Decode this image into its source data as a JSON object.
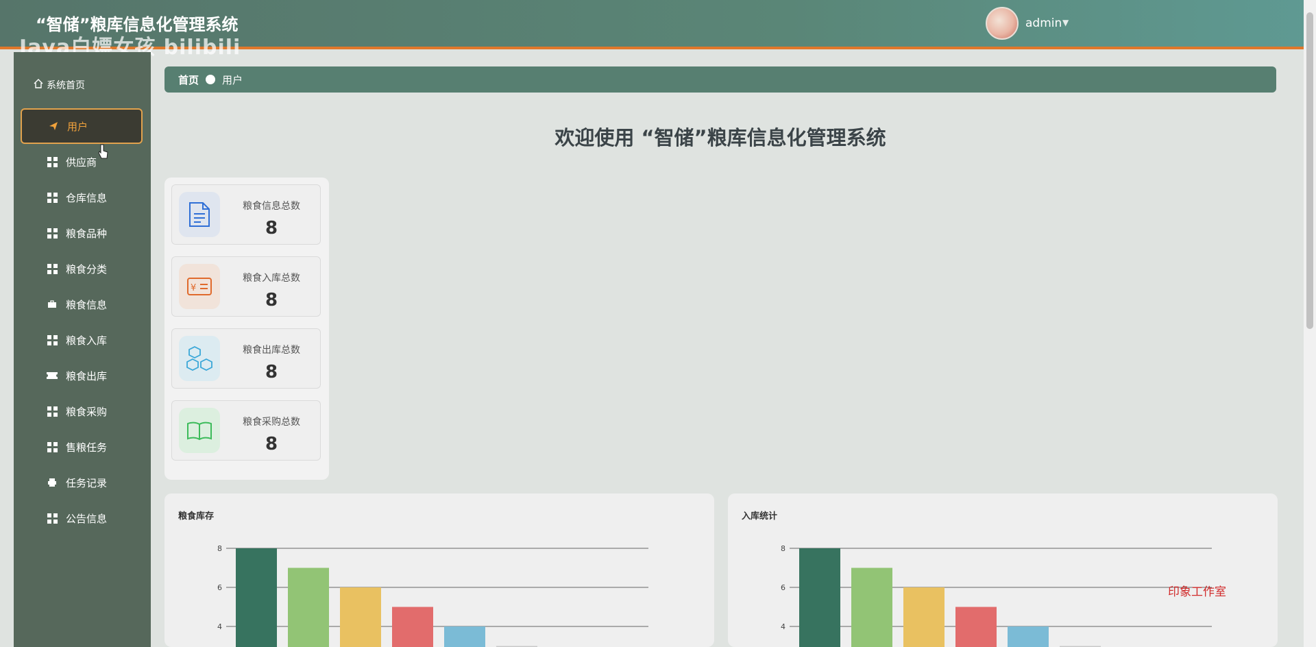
{
  "header": {
    "title": "“智储”粮库信息化管理系统",
    "watermark": "Java白嫖女孩 bilibili",
    "user": "admin",
    "caret": "▼"
  },
  "sidebar": {
    "home_label": "系统首页",
    "items": [
      {
        "label": "用户",
        "icon": "paper-plane-icon",
        "active": true
      },
      {
        "label": "供应商",
        "icon": "grid-icon"
      },
      {
        "label": "仓库信息",
        "icon": "grid-icon"
      },
      {
        "label": "粮食品种",
        "icon": "grid-icon"
      },
      {
        "label": "粮食分类",
        "icon": "grid-icon"
      },
      {
        "label": "粮食信息",
        "icon": "briefcase-icon"
      },
      {
        "label": "粮食入库",
        "icon": "grid-icon"
      },
      {
        "label": "粮食出库",
        "icon": "ticket-icon"
      },
      {
        "label": "粮食采购",
        "icon": "grid-icon"
      },
      {
        "label": "售粮任务",
        "icon": "grid-icon"
      },
      {
        "label": "任务记录",
        "icon": "printer-icon"
      },
      {
        "label": "公告信息",
        "icon": "grid-icon"
      }
    ]
  },
  "breadcrumb": {
    "home": "首页",
    "current": "用户"
  },
  "welcome": "欢迎使用 “智储”粮库信息化管理系统",
  "stats": [
    {
      "label": "粮食信息总数",
      "value": "8",
      "icon": "document-icon",
      "color": "#2f6fd6",
      "bg": "#dfe5ef"
    },
    {
      "label": "粮食入库总数",
      "value": "8",
      "icon": "yen-card-icon",
      "color": "#e06a2c",
      "bg": "#f1e3da"
    },
    {
      "label": "粮食出库总数",
      "value": "8",
      "icon": "cubes-icon",
      "color": "#3aa7d8",
      "bg": "#dcebf1"
    },
    {
      "label": "粮食采购总数",
      "value": "8",
      "icon": "book-icon",
      "color": "#3cbb5a",
      "bg": "#dcefdf"
    }
  ],
  "colors": {
    "header_accent": "#e0782b",
    "active_text": "#f1a23c",
    "bar_palette": [
      "#37735f",
      "#92c475",
      "#e9c161",
      "#e26c6c",
      "#7bbbd6",
      "#c9c9c9"
    ]
  },
  "chart_data": [
    {
      "type": "bar",
      "title": "粮食库存",
      "values": [
        8,
        7,
        6,
        5,
        4,
        3
      ],
      "ylim": [
        0,
        8
      ],
      "yticks": [
        "8",
        "6",
        "4"
      ],
      "grid": true
    },
    {
      "type": "bar",
      "title": "入库统计",
      "values": [
        8,
        7,
        6,
        5,
        4,
        3
      ],
      "ylim": [
        0,
        8
      ],
      "yticks": [
        "8",
        "6",
        "4"
      ],
      "grid": true
    }
  ],
  "overlay_text": "印象工作室"
}
